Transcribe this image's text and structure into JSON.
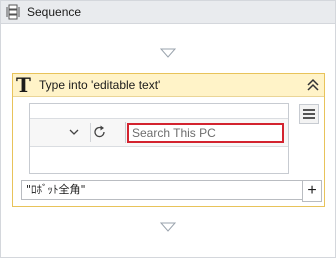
{
  "sequence": {
    "title": "Sequence",
    "icon": "sequence-icon"
  },
  "activity": {
    "title": "Type into 'editable text'",
    "icon": "type-into-icon",
    "accent_border": "#e8c35a",
    "header_bg": "#fff3c8"
  },
  "preview": {
    "search_placeholder": "Search This PC",
    "highlight_color": "#d3232f"
  },
  "text_input": {
    "value": "\"ﾛﾎﾞｯﾄ全角\""
  },
  "icons": {
    "collapse": "double-chevron-up-icon",
    "menu": "hamburger-menu-icon",
    "add": "plus-icon",
    "drop": "drop-triangle-icon"
  },
  "add_label": "+"
}
